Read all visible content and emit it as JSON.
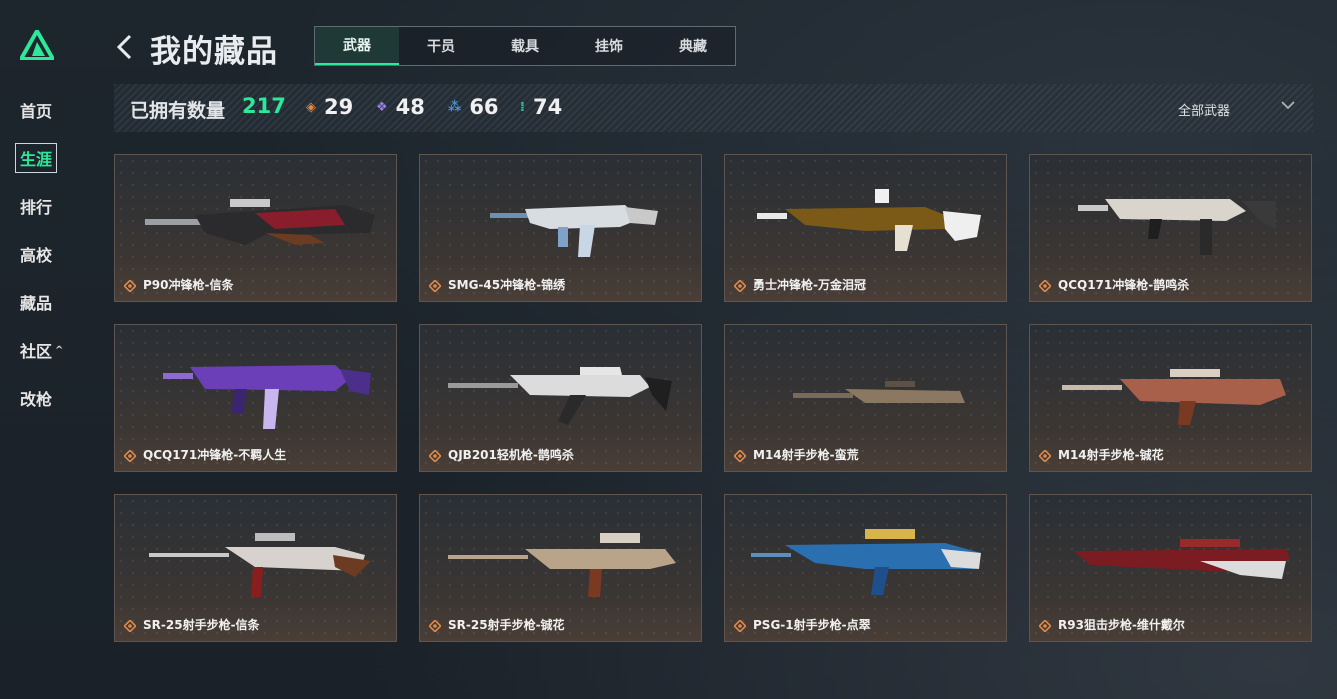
{
  "sidebar": {
    "items": [
      {
        "label": "首页"
      },
      {
        "label": "生涯"
      },
      {
        "label": "排行"
      },
      {
        "label": "高校"
      },
      {
        "label": "藏品"
      },
      {
        "label": "社区"
      },
      {
        "label": "改枪"
      }
    ]
  },
  "header": {
    "title": "我的藏品",
    "tabs": [
      {
        "label": "武器"
      },
      {
        "label": "干员"
      },
      {
        "label": "载具"
      },
      {
        "label": "挂饰"
      },
      {
        "label": "典藏"
      }
    ]
  },
  "stats": {
    "owned_label": "已拥有数量",
    "owned_count": "217",
    "rarity": [
      {
        "count": "29",
        "color": "#e08a4a"
      },
      {
        "count": "48",
        "color": "#9a7ee0"
      },
      {
        "count": "66",
        "color": "#4a8fd8"
      },
      {
        "count": "74",
        "color": "#2ec9a0"
      }
    ],
    "filter_label": "全部武器"
  },
  "items": [
    {
      "name": "P90冲锋枪-信条"
    },
    {
      "name": "SMG-45冲锋枪-锦绣"
    },
    {
      "name": "勇士冲锋枪-万金泪冠"
    },
    {
      "name": "QCQ171冲锋枪-鹊鸣杀"
    },
    {
      "name": "QCQ171冲锋枪-不羁人生"
    },
    {
      "name": "QJB201轻机枪-鹊鸣杀"
    },
    {
      "name": "M14射手步枪-蛮荒"
    },
    {
      "name": "M14射手步枪-铖花"
    },
    {
      "name": "SR-25射手步枪-信条"
    },
    {
      "name": "SR-25射手步枪-铖花"
    },
    {
      "name": "PSG-1射手步枪-点翠"
    },
    {
      "name": "R93狙击步枪-维什戴尔"
    }
  ],
  "colors": {
    "accent": "#2ee89a",
    "legendary": "#e08a4a"
  }
}
